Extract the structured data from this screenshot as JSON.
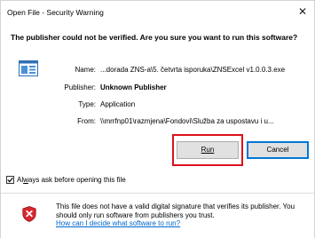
{
  "window": {
    "title": "Open File - Security Warning",
    "close_symbol": "✕"
  },
  "question": "The publisher could not be verified.  Are you sure you want to run this software?",
  "details": {
    "name_label": "Name:",
    "name_value": "...dorada ZNS-a\\5. četvrta isporuka\\ZNSExcel v1.0.0.3.exe",
    "publisher_label": "Publisher:",
    "publisher_value": "Unknown Publisher",
    "type_label": "Type:",
    "type_value": "Application",
    "from_label": "From:",
    "from_value": "\\\\mrrfnp01\\razmjena\\Fondovi\\Služba za uspostavu i u..."
  },
  "buttons": {
    "run_label": "Run",
    "cancel_label": "Cancel"
  },
  "checkbox": {
    "label_prefix": "Al",
    "label_underlined": "w",
    "label_suffix": "ays ask before opening this file",
    "checked": true
  },
  "footer": {
    "message": "This file does not have a valid digital signature that verifies its publisher.  You should only run software from publishers you trust.",
    "link_text": "How can I decide what software to run?"
  },
  "icons": {
    "file": "application-file-icon",
    "shield": "security-shield-warning-icon",
    "check": "checkmark-icon"
  },
  "colors": {
    "highlight": "#e0101b",
    "default_button_border": "#0078d7",
    "link": "#0066cc",
    "shield_red": "#d9262e"
  }
}
